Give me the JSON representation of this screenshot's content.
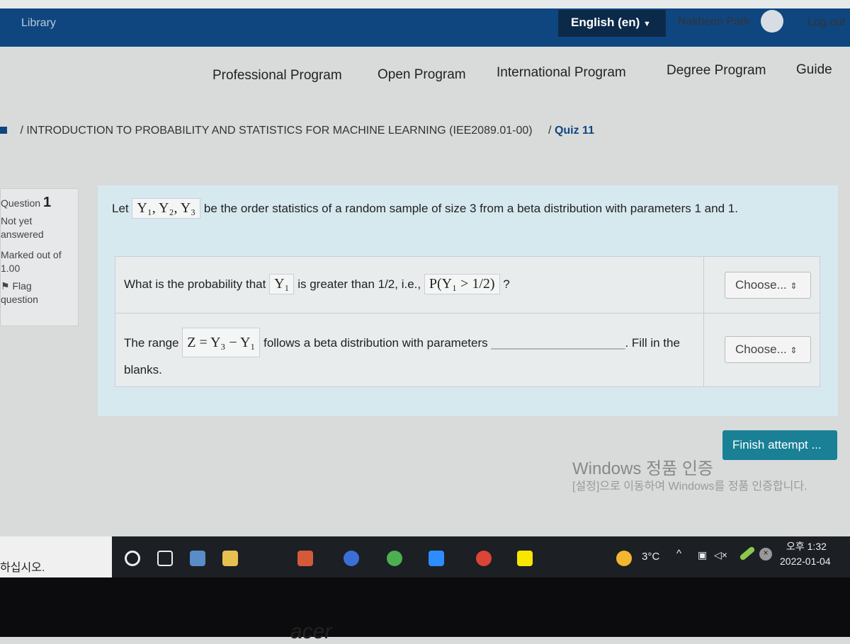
{
  "header": {
    "library": "Library",
    "language": "English (en)",
    "user": "Nakheon Park",
    "logout": "Log out"
  },
  "nav": [
    "Professional Program",
    "Open Program",
    "International Program",
    "Degree Program",
    "Guide"
  ],
  "breadcrumb": {
    "course": "/ INTRODUCTION TO PROBABILITY AND STATISTICS FOR MACHINE LEARNING (IEE2089.01-00)",
    "sep": "/",
    "current": "Quiz 11"
  },
  "question_info": {
    "label": "Question",
    "number": "1",
    "status": "Not yet answered",
    "marked": "Marked out of",
    "mark": "1.00",
    "flag": "Flag question"
  },
  "question": {
    "let": "Let",
    "vars": "Y₁, Y₂, Y₃",
    "text": "be the order statistics of a random sample of size 3 from a beta distribution with parameters 1 and 1.",
    "row1": {
      "pre": "What is the probability that",
      "var": "Y₁",
      "mid": "is greater than 1/2, i.e.,",
      "expr": "P(Y₁ > 1/2)",
      "post": "?",
      "select": "Choose..."
    },
    "row2": {
      "pre": "The range",
      "expr": "Z = Y₃ − Y₁",
      "mid": "follows a beta distribution with parameters",
      "blank": "____________________",
      "post": ". Fill in the blanks.",
      "select": "Choose..."
    }
  },
  "finish": "Finish attempt ...",
  "watermark": {
    "title": "Windows 정품 인증",
    "text": "[설정]으로 이동하여 Windows를 정품 인증합니다."
  },
  "taskbar": {
    "search": "하십시오.",
    "temp": "3°C",
    "time": "오후 1:32",
    "date": "2022-01-04"
  },
  "colors": {
    "header": "#0f4680",
    "accent": "#1a8096",
    "question_bg": "#d6e9ee"
  }
}
